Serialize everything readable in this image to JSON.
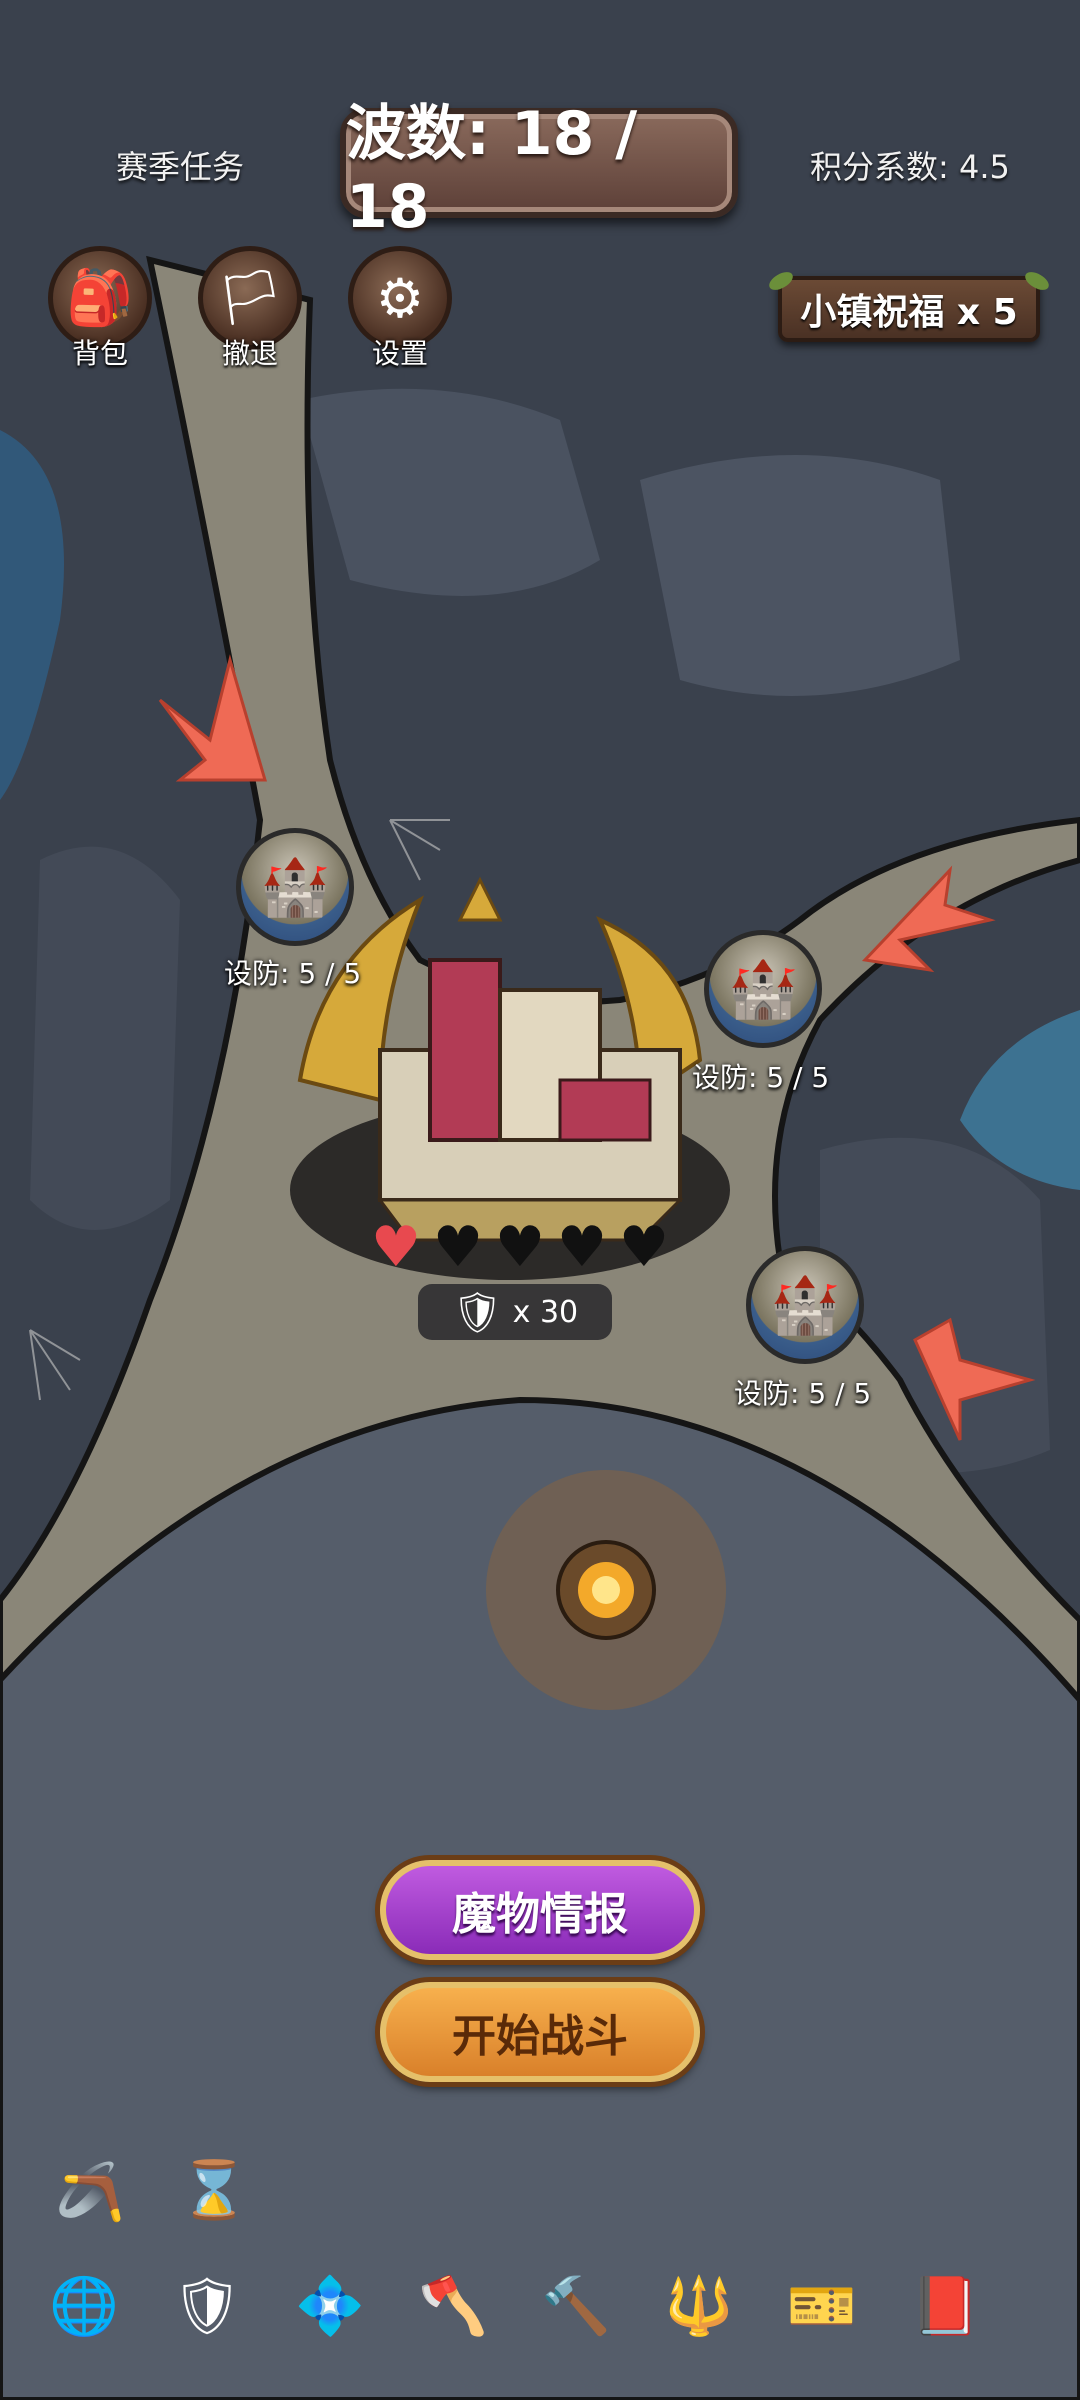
{
  "hud": {
    "season_tasks": "赛季任务",
    "wave_label": "波数: 18 / 18",
    "score_coefficient": "积分系数: 4.5",
    "town_blessing": "小镇祝福 x 5"
  },
  "menu": [
    {
      "label": "背包",
      "icon": "backpack-icon"
    },
    {
      "label": "撤退",
      "icon": "retreat-flag-icon"
    },
    {
      "label": "设置",
      "icon": "gear-icon"
    }
  ],
  "towers": [
    {
      "label": "设防: 5 / 5"
    },
    {
      "label": "设防: 5 / 5"
    },
    {
      "label": "设防: 5 / 5"
    }
  ],
  "base": {
    "hearts_full": 1,
    "hearts_total": 5,
    "coin_count": "x 30",
    "colors": {
      "heart_full": "#e8494f",
      "heart_empty": "#111111"
    }
  },
  "buttons": {
    "monster_intel": "魔物情报",
    "start_battle": "开始战斗"
  },
  "top_items": [
    "scythe-icon",
    "hourglass-icon"
  ],
  "inventory": [
    "globe-icon",
    "shield-icon",
    "gem-icon",
    "axe-icon",
    "hammer-icon",
    "staff-icon",
    "tickets-icon",
    "book-icon"
  ],
  "colors": {
    "map_base": "#3b4350",
    "path": "#8a8678",
    "arrow": "#ef6a55"
  }
}
